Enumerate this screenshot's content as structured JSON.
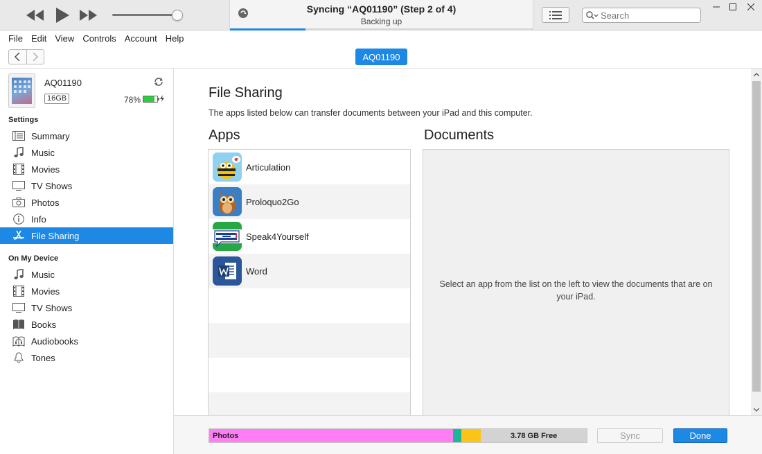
{
  "player": {
    "lcd_title": "Syncing “AQ01190” (Step 2 of 4)",
    "lcd_subtitle": "Backing up",
    "progress": 0.25
  },
  "search": {
    "placeholder": "Search"
  },
  "menu": [
    "File",
    "Edit",
    "View",
    "Controls",
    "Account",
    "Help"
  ],
  "device": {
    "pill_label": "AQ01190",
    "name": "AQ01190",
    "capacity": "16GB",
    "battery_pct": "78%",
    "battery_level": 0.78
  },
  "sidebar": {
    "settings_heading": "Settings",
    "settings_items": [
      {
        "label": "Summary",
        "icon": "summary-icon"
      },
      {
        "label": "Music",
        "icon": "music-icon"
      },
      {
        "label": "Movies",
        "icon": "movies-icon"
      },
      {
        "label": "TV Shows",
        "icon": "tv-icon"
      },
      {
        "label": "Photos",
        "icon": "camera-icon"
      },
      {
        "label": "Info",
        "icon": "info-icon"
      },
      {
        "label": "File Sharing",
        "icon": "app-store-icon",
        "active": true
      }
    ],
    "device_heading": "On My Device",
    "device_items": [
      {
        "label": "Music",
        "icon": "music-icon"
      },
      {
        "label": "Movies",
        "icon": "movies-icon"
      },
      {
        "label": "TV Shows",
        "icon": "tv-icon"
      },
      {
        "label": "Books",
        "icon": "books-icon"
      },
      {
        "label": "Audiobooks",
        "icon": "audiobook-icon"
      },
      {
        "label": "Tones",
        "icon": "bell-icon"
      }
    ]
  },
  "main": {
    "title": "File Sharing",
    "description": "The apps listed below can transfer documents between your iPad and this computer.",
    "apps_heading": "Apps",
    "docs_heading": "Documents",
    "apps": [
      {
        "label": "Articulation",
        "icon": "articulation-app-icon"
      },
      {
        "label": "Proloquo2Go",
        "icon": "proloquo2go-app-icon"
      },
      {
        "label": "Speak4Yourself",
        "icon": "speak4yourself-app-icon"
      },
      {
        "label": "Word",
        "icon": "word-app-icon"
      }
    ],
    "docs_message": "Select an app from the list on the left to view the documents that are on your iPad."
  },
  "storage": {
    "photos_label": "Photos",
    "free_label": "3.78 GB Free",
    "segments": [
      {
        "name": "Photos",
        "fraction": 0.645,
        "color": "#ff7ef4"
      },
      {
        "name": "Apps",
        "fraction": 0.023,
        "color": "#1fb59a"
      },
      {
        "name": "Other",
        "fraction": 0.052,
        "color": "#fcc419"
      }
    ]
  },
  "buttons": {
    "sync": "Sync",
    "done": "Done"
  },
  "colors": {
    "accent": "#1e88e5"
  }
}
